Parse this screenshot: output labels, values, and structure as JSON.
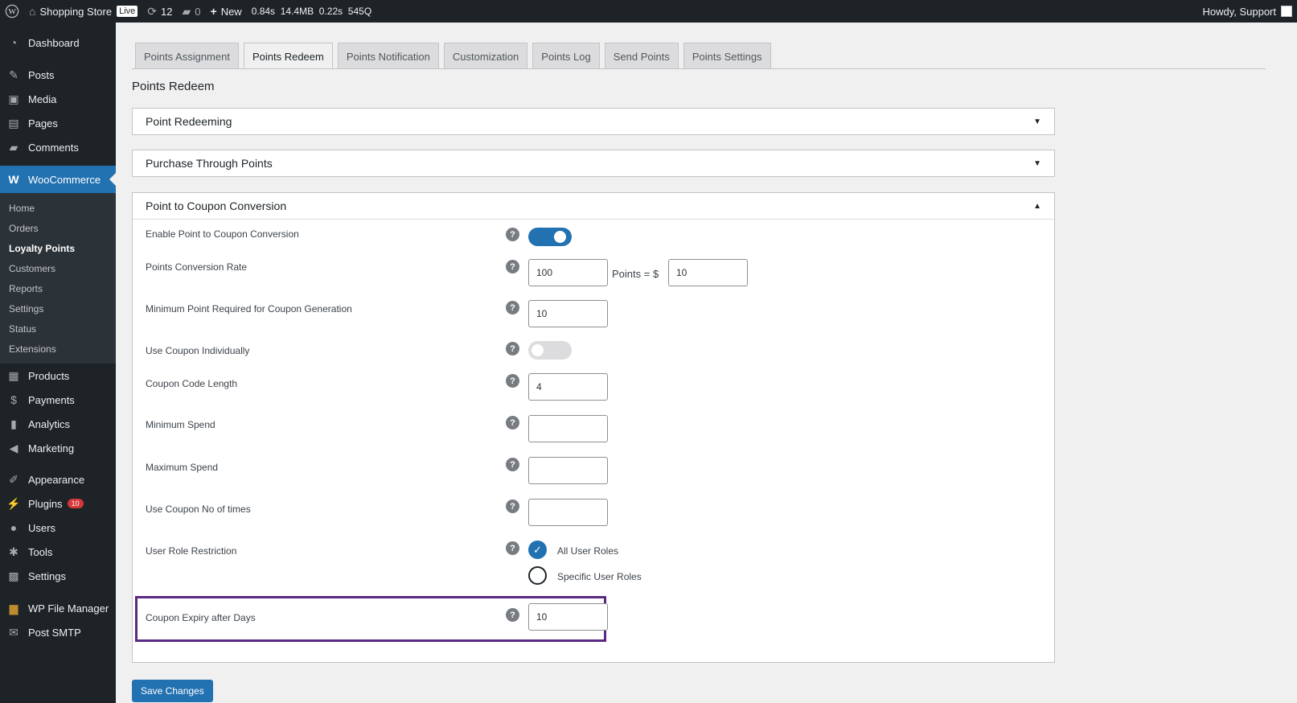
{
  "adminbar": {
    "site_name": "Shopping Store",
    "live_badge": "Live",
    "updates_count": "12",
    "comments_count": "0",
    "new_label": "New",
    "perf": [
      "0.84s",
      "14.4MB",
      "0.22s",
      "545Q"
    ],
    "greeting": "Howdy, Support"
  },
  "sidebar": {
    "dashboard": "Dashboard",
    "posts": "Posts",
    "media": "Media",
    "pages": "Pages",
    "comments": "Comments",
    "woocommerce": "WooCommerce",
    "submenu": [
      "Home",
      "Orders",
      "Loyalty Points",
      "Customers",
      "Reports",
      "Settings",
      "Status",
      "Extensions"
    ],
    "products": "Products",
    "payments": "Payments",
    "analytics": "Analytics",
    "marketing": "Marketing",
    "appearance": "Appearance",
    "plugins": "Plugins",
    "plugins_badge": "10",
    "users": "Users",
    "tools": "Tools",
    "settings": "Settings",
    "file_manager": "WP File Manager",
    "post_smtp": "Post SMTP"
  },
  "tabs": [
    "Points Assignment",
    "Points Redeem",
    "Points Notification",
    "Customization",
    "Points Log",
    "Send Points",
    "Points Settings"
  ],
  "page_title": "Points Redeem",
  "panels": {
    "redeeming": "Point Redeeming",
    "purchase": "Purchase Through Points",
    "coupon": "Point to Coupon Conversion"
  },
  "form": {
    "enable_label": "Enable Point to Coupon Conversion",
    "enable_state": true,
    "rate_label": "Points Conversion Rate",
    "rate_points": "100",
    "rate_mid": "Points = $",
    "rate_amount": "10",
    "min_point_label": "Minimum Point Required for Coupon Generation",
    "min_point_value": "10",
    "individual_label": "Use Coupon Individually",
    "individual_state": false,
    "code_length_label": "Coupon Code Length",
    "code_length_value": "4",
    "min_spend_label": "Minimum Spend",
    "min_spend_value": "",
    "max_spend_label": "Maximum Spend",
    "max_spend_value": "",
    "use_times_label": "Use Coupon No of times",
    "use_times_value": "",
    "role_label": "User Role Restriction",
    "role_all": "All User Roles",
    "role_specific": "Specific User Roles",
    "expiry_label": "Coupon Expiry after Days",
    "expiry_value": "10",
    "help_glyph": "?"
  },
  "save_label": "Save Changes",
  "colors": {
    "accent": "#2271b1",
    "highlight": "#5a2a82",
    "admin_dark": "#1d2327"
  }
}
